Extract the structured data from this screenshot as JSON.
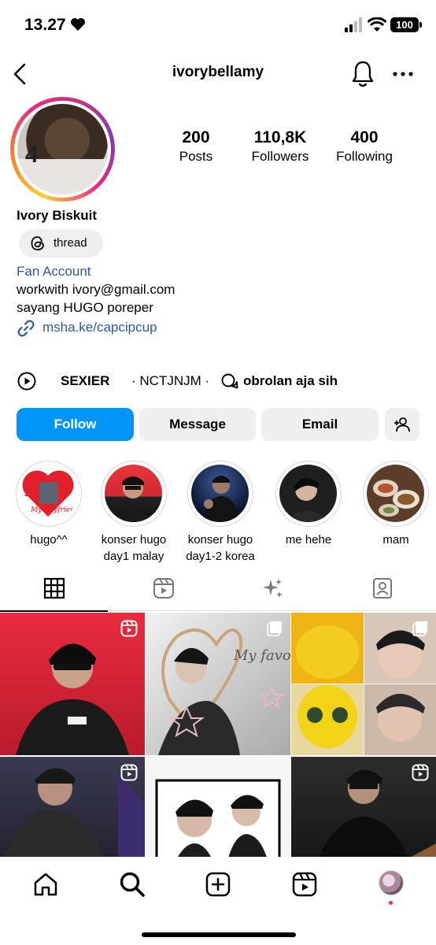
{
  "status_bar": {
    "time": "13.27",
    "battery": "100"
  },
  "header": {
    "username": "ivorybellamy"
  },
  "profile": {
    "stats": [
      {
        "value": "200",
        "label": "Posts"
      },
      {
        "value": "110,8K",
        "label": "Followers"
      },
      {
        "value": "400",
        "label": "Following"
      }
    ],
    "display_name": "Ivory Biskuit",
    "threads_label": "thread",
    "category": "Fan Account",
    "bio_lines": [
      "workwith ivory@gmail.com",
      "sayang HUGO poreper"
    ],
    "link": "msha.ke/capcipcup"
  },
  "channels": {
    "items": [
      "SEXIER",
      "· NCTJNJM ·",
      "obrolan aja sih"
    ]
  },
  "actions": {
    "follow": "Follow",
    "message": "Message",
    "email": "Email"
  },
  "highlights": [
    {
      "label": "hugo^^",
      "icon": "highlight-hugo"
    },
    {
      "label": "konser hugo day1 malay",
      "icon": "highlight-concert-malay"
    },
    {
      "label": "konser hugo day1-2 korea",
      "icon": "highlight-concert-korea"
    },
    {
      "label": "me hehe",
      "icon": "highlight-me"
    },
    {
      "label": "mam",
      "icon": "highlight-food"
    }
  ],
  "highlight_art_text": {
    "love": "I",
    "subtitle": "My Boyfriend"
  },
  "grid_art_text": {
    "caption": "My favorite boy"
  },
  "tabs": [
    "grid-tab",
    "reels-tab",
    "ai-sparkle-tab",
    "tagged-tab"
  ],
  "colors": {
    "accent": "#0095f6",
    "link": "#2a5b9b",
    "notification_dot": "#ff3040"
  }
}
